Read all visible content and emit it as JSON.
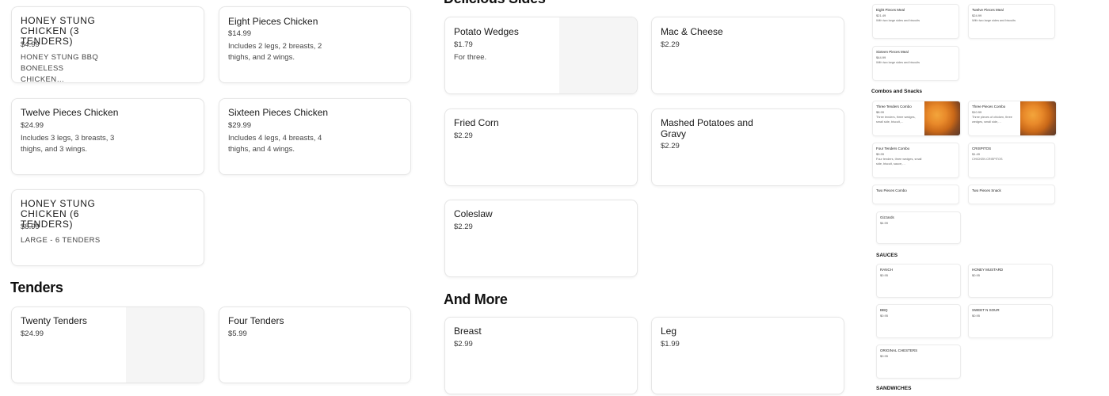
{
  "left_column": {
    "cards": [
      {
        "name": "HONEY STUNG CHICKEN (3 TENDERS)",
        "price": "$4.99",
        "desc": "HONEY STUNG BBQ BONELESS CHICKEN…"
      },
      {
        "name": "Eight Pieces Chicken",
        "price": "$14.99",
        "desc": "Includes 2 legs, 2 breasts, 2 thighs, and 2 wings."
      },
      {
        "name": "Twelve Pieces Chicken",
        "price": "$24.99",
        "desc": "Includes 3 legs, 3 breasts, 3 thighs, and 3 wings."
      },
      {
        "name": "Sixteen Pieces Chicken",
        "price": "$29.99",
        "desc": "Includes 4 legs, 4 breasts, 4 thighs, and 4 wings."
      },
      {
        "name": "HONEY STUNG CHICKEN (6 TENDERS)",
        "price": "$8.99",
        "desc": "LARGE - 6 TENDERS"
      }
    ],
    "tenders_heading": "Tenders",
    "tenders": [
      {
        "name": "Twenty Tenders",
        "price": "$24.99"
      },
      {
        "name": "Four Tenders",
        "price": "$5.99"
      }
    ]
  },
  "middle_column": {
    "sides_heading": "Delicious Sides",
    "sides": [
      {
        "name": "Potato Wedges",
        "price": "$1.79",
        "desc": "For three."
      },
      {
        "name": "Mac & Cheese",
        "price": "$2.29"
      },
      {
        "name": "Fried Corn",
        "price": "$2.29"
      },
      {
        "name": "Mashed Potatoes and Gravy",
        "price": "$2.29"
      },
      {
        "name": "Coleslaw",
        "price": "$2.29"
      }
    ],
    "more_heading": "And More",
    "more": [
      {
        "name": "Breast",
        "price": "$2.99"
      },
      {
        "name": "Leg",
        "price": "$1.99"
      }
    ]
  },
  "mini_panel": {
    "meals": [
      {
        "name": "Eight Pieces Meal",
        "price": "$21.49",
        "desc": "With two large sides and biscuits"
      },
      {
        "name": "Twelve Pieces Meal",
        "price": "$24.99",
        "desc": "With two large sides and biscuits"
      },
      {
        "name": "Sixteen Pieces Meal",
        "price": "$44.99",
        "desc": "With two large sides and biscuits"
      }
    ],
    "combos_heading": "Combos and Snacks",
    "combos": [
      {
        "name": "Three Tenders Combo",
        "price": "$8.99",
        "desc": "Three tenders, three wedges, small side, biscuit,…"
      },
      {
        "name": "Three Pieces Combo",
        "price": "$10.99",
        "desc": "Three pieces of chicken, three wedges, small side,…"
      },
      {
        "name": "Four Tenders Combo",
        "price": "$9.99",
        "desc": "Four tenders, three wedges, small side, biscuit, sauce,…"
      },
      {
        "name": "CRISPITOS",
        "price": "$1.49",
        "desc": "CHICKEN CRISPITOS"
      },
      {
        "name": "Two Pieces Combo",
        "price": "",
        "desc": ""
      },
      {
        "name": "Two Pieces Snack",
        "price": "",
        "desc": ""
      },
      {
        "name": "Gizzards",
        "price": "$4.99",
        "desc": ""
      }
    ],
    "sauces_heading": "SAUCES",
    "sauces": [
      {
        "name": "RANCH",
        "price": "$0.95"
      },
      {
        "name": "HONEY MUSTARD",
        "price": "$0.95"
      },
      {
        "name": "BBQ",
        "price": "$0.95"
      },
      {
        "name": "SWEET N SOUR",
        "price": "$0.95"
      },
      {
        "name": "ORIGINAL CHESTERS",
        "price": "$0.95"
      }
    ],
    "sandwiches_heading": "SANDWICHES"
  }
}
